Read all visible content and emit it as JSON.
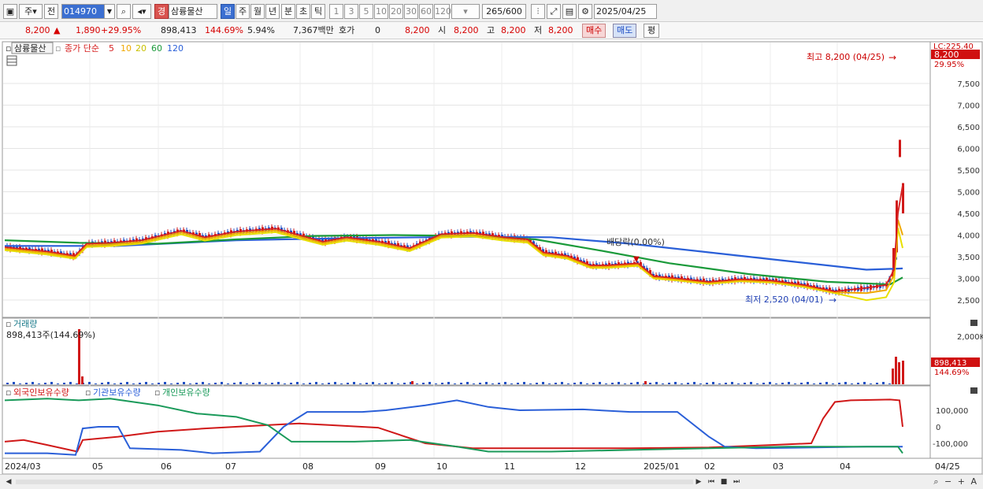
{
  "toolbar": {
    "period_label": "주",
    "prev_label": "전",
    "stock_code": "014970",
    "stock_name": "삼륭물산",
    "badge": "경",
    "period_tabs": [
      "일",
      "주",
      "월",
      "년",
      "분",
      "초",
      "틱"
    ],
    "minute_options": [
      "1",
      "3",
      "5",
      "10",
      "20",
      "30",
      "60",
      "120"
    ],
    "count": "265",
    "count_total": "/600",
    "date": "2025/04/25"
  },
  "quote": {
    "price": "8,200",
    "change": "1,890",
    "change_pct": "+29.95%",
    "volume": "898,413",
    "volume_ratio": "144.69%",
    "turnover": "5.94%",
    "amount": "7,367백만",
    "hoga_label": "호가",
    "hoga_value": "0",
    "hoga_price": "8,200",
    "open_label": "시",
    "open": "8,200",
    "high_label": "고",
    "high": "8,200",
    "low_label": "저",
    "low": "8,200",
    "buy_label": "매수",
    "sell_label": "매도",
    "avg_label": "평"
  },
  "legend": {
    "name": "삼륭물산",
    "ma_label": "종가 단순",
    "ma_periods": [
      "5",
      "10",
      "20",
      "60",
      "120"
    ],
    "ma_colors": [
      "#d62020",
      "#f0a800",
      "#e8e000",
      "#1a9a3a",
      "#2a5fd8"
    ]
  },
  "annotations": {
    "high": "최고 8,200 (04/25)",
    "low": "최저 2,520 (04/01)",
    "dividend": "배당락(0.00%)",
    "lc": "LC:225.40",
    "price_tag": "8,200",
    "pct_tag": "29.95%",
    "vol_tag": "898,413",
    "vol_pct_tag": "144.69%"
  },
  "volume_panel": {
    "title": "거래량",
    "value": "898,413주(144.69%)",
    "axis": [
      "2,000K"
    ]
  },
  "holdings_panel": {
    "series": [
      "외국인보유수량",
      "기관보유수량",
      "개인보유수량"
    ],
    "colors": [
      "#d01818",
      "#2a5fd8",
      "#1a9a5a"
    ],
    "axis": [
      "100,000",
      "0",
      "-100,000"
    ]
  },
  "price_axis": [
    "7,500",
    "7,000",
    "6,500",
    "6,000",
    "5,500",
    "5,000",
    "4,500",
    "4,000",
    "3,500",
    "3,000",
    "2,500"
  ],
  "x_axis": [
    "2024/03",
    "05",
    "06",
    "07",
    "08",
    "09",
    "10",
    "11",
    "12",
    "2025/01",
    "02",
    "03",
    "04",
    "04/25"
  ]
}
